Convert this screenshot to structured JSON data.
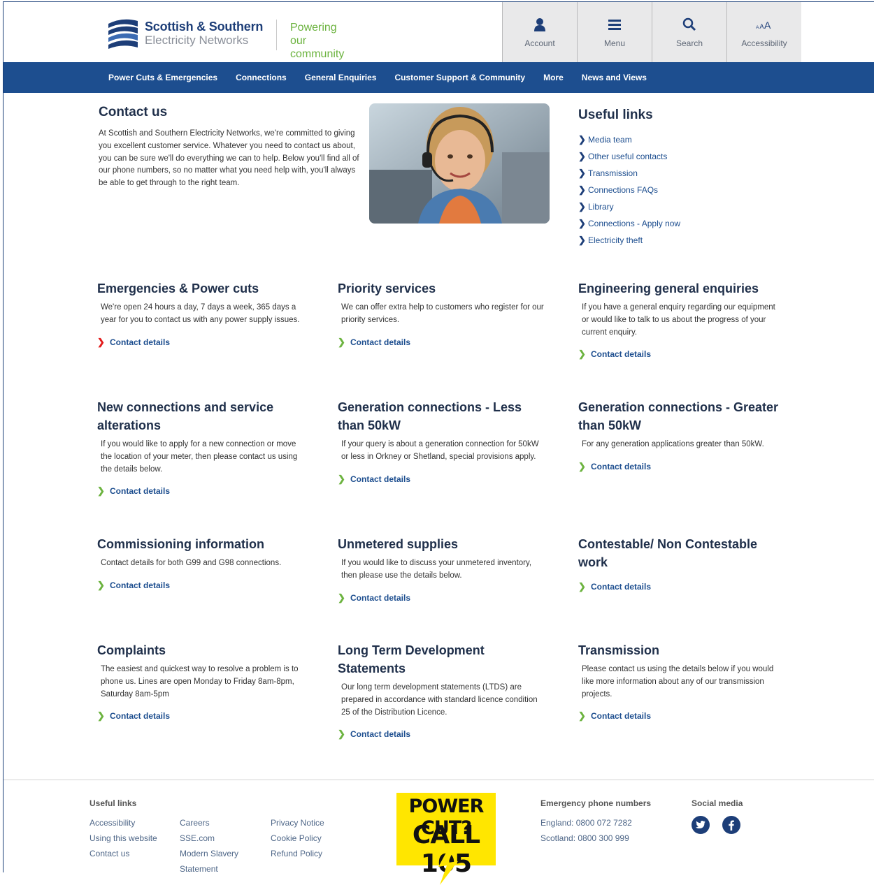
{
  "header": {
    "logo_line1": "Scottish & Southern",
    "logo_line2": "Electricity Networks",
    "tagline_line1": "Powering our",
    "tagline_line2": "community",
    "tools": [
      {
        "label": "Account",
        "icon": "user-icon"
      },
      {
        "label": "Menu",
        "icon": "menu-icon"
      },
      {
        "label": "Search",
        "icon": "search-icon"
      },
      {
        "label": "Accessibility",
        "icon": "text-size-icon"
      }
    ]
  },
  "nav": {
    "items": [
      "Power Cuts & Emergencies",
      "Connections",
      "General Enquiries",
      "Customer Support & Community",
      "More",
      "News and Views"
    ]
  },
  "intro": {
    "title": "Contact us",
    "text": "At Scottish and Southern Electricity Networks, we're committed to giving you excellent customer service. Whatever you need to contact us about, you can be sure we'll do everything we can to help. Below you'll find all of our phone numbers, so no matter what you need help with, you'll always be able to get through to the right team."
  },
  "useful_links": {
    "title": "Useful links",
    "items": [
      "Media team",
      "Other useful contacts",
      "Transmission",
      "Connections FAQs",
      "Library",
      "Connections - Apply now",
      "Electricity theft"
    ]
  },
  "cards": [
    {
      "title": "Emergencies & Power cuts",
      "desc": "We're open 24 hours a day, 7 days a week, 365 days a year for you to contact us with any power supply issues.",
      "link": "Contact details"
    },
    {
      "title": "Priority services",
      "desc": "We can offer extra help to customers who register for our priority services.",
      "link": "Contact details"
    },
    {
      "title": "Engineering general enquiries",
      "desc": "If you have a general enquiry regarding our equipment or would like to talk to us about the progress of your current enquiry.",
      "link": "Contact details"
    },
    {
      "title": "New connections and service alterations",
      "desc": "If you would like to apply for a new connection or move the location of your meter, then please contact us using the details below.",
      "link": "Contact details"
    },
    {
      "title": "Generation connections - Less than 50kW",
      "desc": "If your query is about a generation connection for 50kW or less in Orkney or Shetland, special provisions apply.",
      "link": "Contact details"
    },
    {
      "title": "Generation connections - Greater than 50kW",
      "desc": "For any generation applications greater than 50kW.",
      "link": "Contact details"
    },
    {
      "title": "Commissioning information",
      "desc": "Contact details for both G99 and G98 connections.",
      "link": "Contact details"
    },
    {
      "title": "Unmetered supplies",
      "desc": "If you would like to discuss your unmetered inventory, then please use the details below.",
      "link": "Contact details"
    },
    {
      "title": "Contestable/ Non Contestable work",
      "desc": "",
      "link": "Contact details"
    },
    {
      "title": "Complaints",
      "desc": "The easiest and quickest way to resolve a problem is to phone us. Lines are open Monday to Friday 8am-8pm, Saturday 8am-5pm",
      "link": "Contact details"
    },
    {
      "title": "Long Term Development Statements",
      "desc": "Our long term development statements (LTDS) are prepared in accordance with standard licence condition 25 of the Distribution Licence.",
      "link": "Contact details"
    },
    {
      "title": "Transmission",
      "desc": "Please contact us using the details below if you would like more information about any of our transmission projects.",
      "link": "Contact details"
    }
  ],
  "footer": {
    "useful_title": "Useful links",
    "col1": [
      "Accessibility",
      "Using this website",
      "Contact us"
    ],
    "col2": [
      "Careers",
      "SSE.com",
      "Modern Slavery",
      "Statement"
    ],
    "col3": [
      "Privacy Notice",
      "Cookie Policy",
      "Refund Policy"
    ],
    "powercut_line1": "POWER CUT?",
    "powercut_line2": "CALL 105",
    "emergency_title": "Emergency phone numbers",
    "england": "England: 0800 072 7282",
    "scotland": "Scotland: 0800 300 999",
    "social_title": "Social media"
  },
  "colors": {
    "brand_blue": "#1d4e8f",
    "accent_green": "#6cb33f",
    "alert_red": "#e21b1b",
    "powercut_yellow": "#ffe600"
  }
}
